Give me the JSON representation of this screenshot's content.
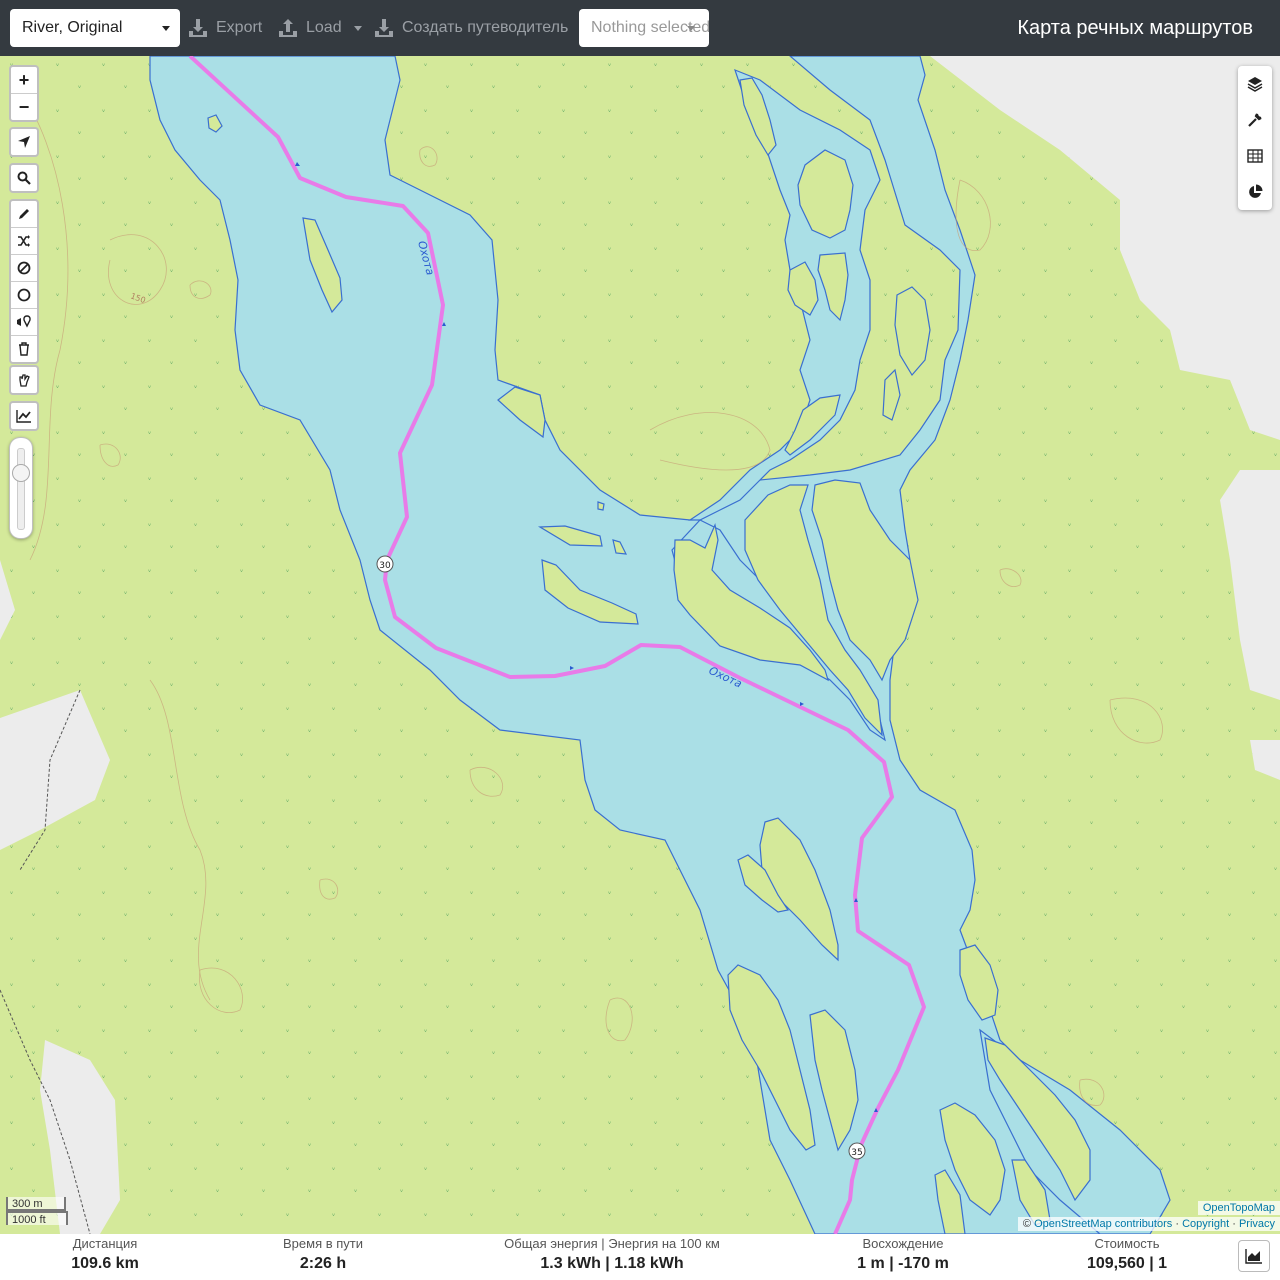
{
  "topbar": {
    "profile": "River, Original",
    "export_label": "Export",
    "load_label": "Load",
    "guide_label": "Создать путеводитель",
    "nothing_selected": "Nothing selected",
    "title": "Карта речных маршрутов"
  },
  "map": {
    "river_label_1": "Охота",
    "river_label_2": "Охота",
    "contour_label": "150",
    "km_markers": [
      "30",
      "35"
    ],
    "scale_metric": "300 m",
    "scale_imperial": "1000 ft",
    "attribution_provider": "OpenTopoMap",
    "attribution_copy": "©",
    "attribution_osm": "OpenStreetMap contributors",
    "attribution_sep1": "·",
    "attribution_copyright": "Copyright",
    "attribution_sep2": "·",
    "attribution_privacy": "Privacy",
    "colors": {
      "water": "#aadfe6",
      "land": "#d4e99a",
      "route": "#e87be8",
      "river_edge": "#3a6fd0"
    },
    "controls": [
      "zoom-in-icon",
      "zoom-out-icon",
      "locate-icon",
      "search-icon",
      "draw-icon",
      "shuffle-icon",
      "no-go-icon",
      "circle-icon",
      "poi-icon",
      "trash-icon",
      "hand-icon",
      "elevation-icon"
    ],
    "right_controls": [
      "layers-icon",
      "wrench-icon",
      "table-icon",
      "pie-chart-icon"
    ],
    "zoom_in_label": "+",
    "zoom_out_label": "−"
  },
  "stats": [
    {
      "label": "Дистанция",
      "value": "109.6 km"
    },
    {
      "label": "Время в пути",
      "value": "2:26 h"
    },
    {
      "label": "Общая энергия | Энергия на 100 км",
      "value": "1.3 kWh | 1.18 kWh"
    },
    {
      "label": "Восхождение",
      "value": "1 m | -170 m"
    },
    {
      "label": "Стоимость",
      "value": "109,560 | 1"
    }
  ]
}
